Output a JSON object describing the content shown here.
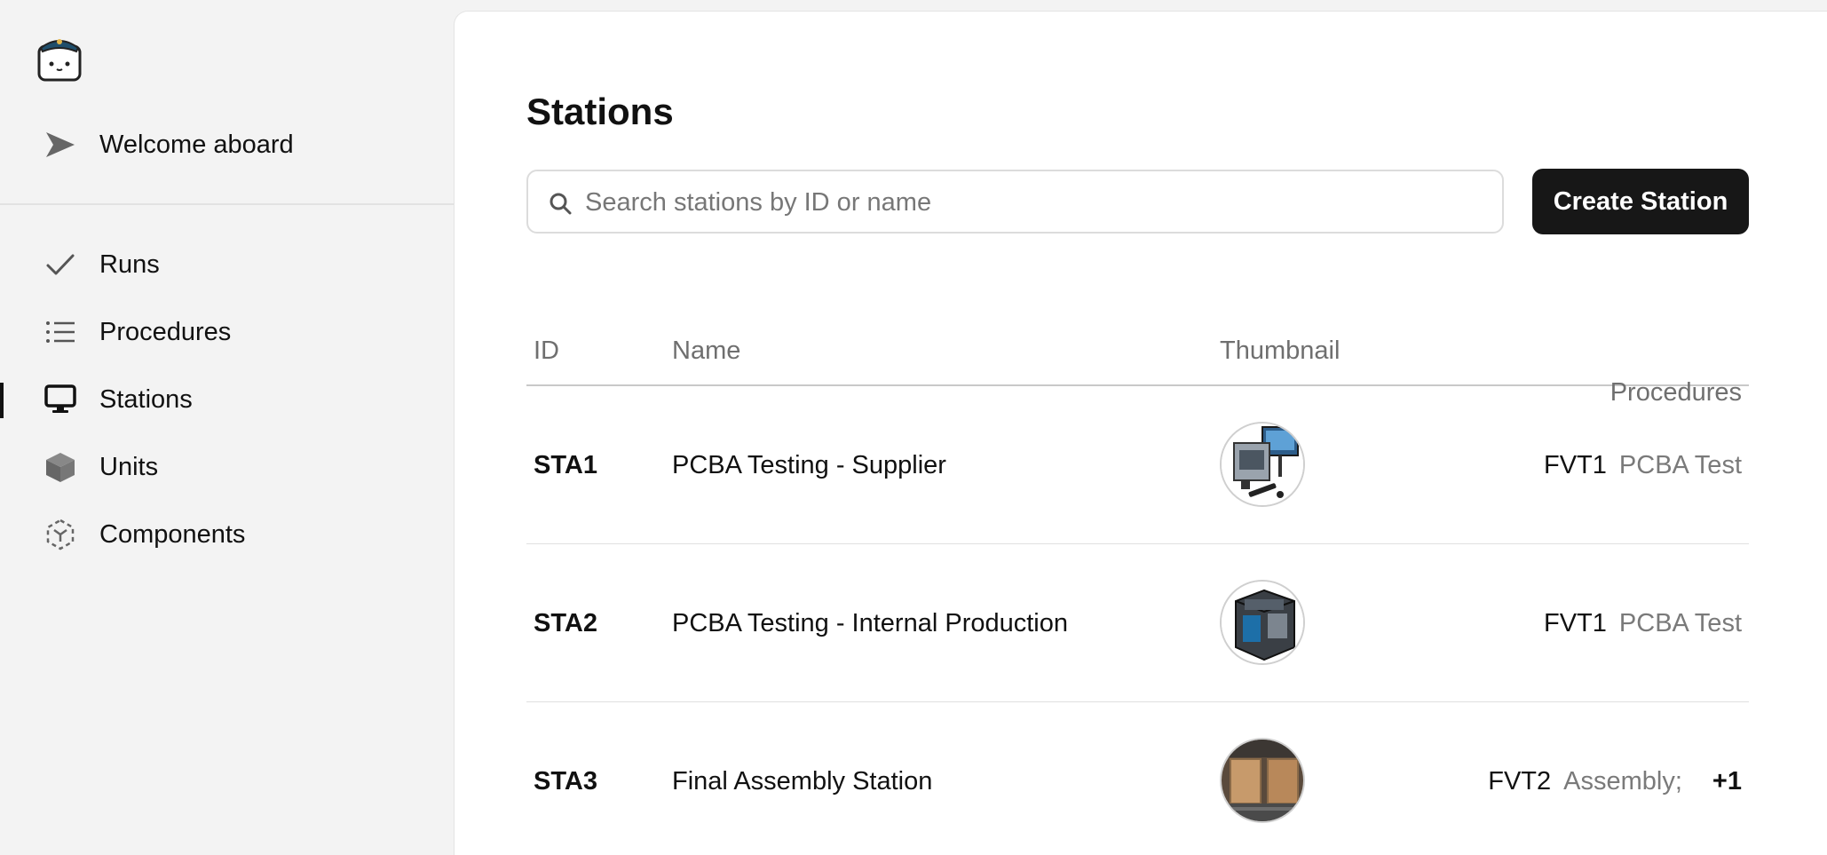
{
  "sidebar": {
    "welcome_label": "Welcome aboard",
    "items": [
      {
        "label": "Runs",
        "icon": "check-icon"
      },
      {
        "label": "Procedures",
        "icon": "list-icon"
      },
      {
        "label": "Stations",
        "icon": "monitor-icon",
        "active": true
      },
      {
        "label": "Units",
        "icon": "cube-icon"
      },
      {
        "label": "Components",
        "icon": "component-icon"
      }
    ]
  },
  "main": {
    "title": "Stations",
    "search": {
      "placeholder": "Search stations by ID or name",
      "value": ""
    },
    "create_button": "Create Station",
    "table": {
      "headers": {
        "id": "ID",
        "name": "Name",
        "thumbnail": "Thumbnail",
        "procedures": "Procedures"
      },
      "rows": [
        {
          "id": "STA1",
          "name": "PCBA Testing - Supplier",
          "proc_code": "FVT1",
          "proc_name": "PCBA Test",
          "more": ""
        },
        {
          "id": "STA2",
          "name": "PCBA Testing - Internal Production",
          "proc_code": "FVT1",
          "proc_name": "PCBA Test",
          "more": ""
        },
        {
          "id": "STA3",
          "name": "Final Assembly Station",
          "proc_code": "FVT2",
          "proc_name": "Assembly;",
          "more": "+1"
        }
      ]
    }
  },
  "colors": {
    "accent": "#171717",
    "sidebar_bg": "#f3f3f3",
    "panel_bg": "#ffffff",
    "muted_text": "#6f6f6f"
  }
}
